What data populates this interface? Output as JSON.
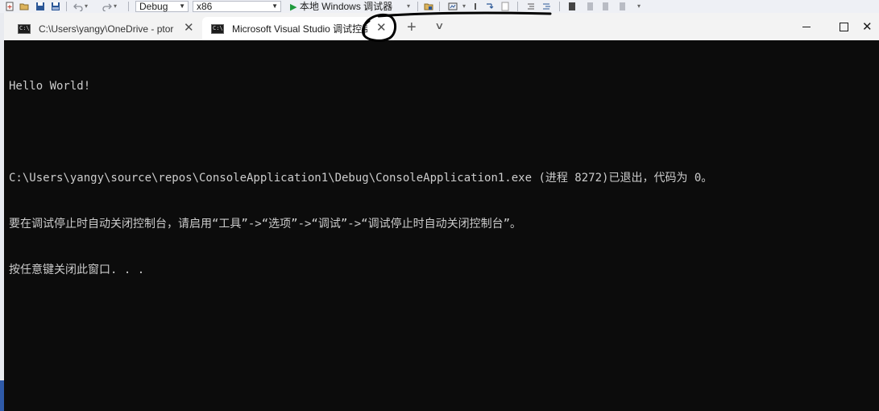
{
  "vs_toolbar": {
    "config_combo": "Debug",
    "platform_combo": "x86",
    "run_button_label": "本地 Windows 调试器"
  },
  "terminal": {
    "tabs": [
      {
        "title": "C:\\Users\\yangy\\OneDrive - ptor",
        "icon": "console-icon",
        "active": false
      },
      {
        "title": "Microsoft Visual Studio 调试控制",
        "icon": "console-icon",
        "active": true
      }
    ],
    "new_tab_icon": "plus-icon",
    "dropdown_icon": "chevron-down-icon",
    "output_lines": [
      "Hello World!",
      "",
      "C:\\Users\\yangy\\source\\repos\\ConsoleApplication1\\Debug\\ConsoleApplication1.exe (进程 8272)已退出，代码为 0。",
      "要在调试停止时自动关闭控制台，请启用“工具”->“选项”->“调试”->“调试停止时自动关闭控制台”。",
      "按任意键关闭此窗口. . ."
    ]
  },
  "colors": {
    "console_bg": "#0c0c0c",
    "console_fg": "#cccccc",
    "titlebar_bg": "#f3f3f3",
    "active_tab_bg": "#ffffff",
    "run_green": "#1e9a3c"
  }
}
